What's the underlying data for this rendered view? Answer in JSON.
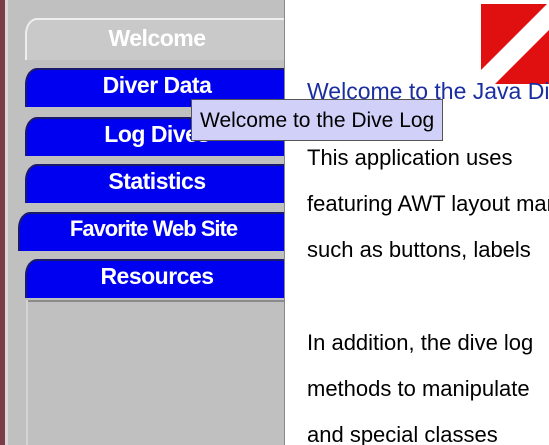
{
  "tabs": [
    {
      "label": "Welcome",
      "selected": true
    },
    {
      "label": "Diver Data",
      "selected": false
    },
    {
      "label": "Log Dives",
      "selected": false
    },
    {
      "label": "Statistics",
      "selected": false
    },
    {
      "label": "Favorite Web Site",
      "selected": false
    },
    {
      "label": "Resources",
      "selected": false
    }
  ],
  "tooltip": {
    "text": "Welcome to the Dive Log"
  },
  "content": {
    "title": "Welcome to the Java Dive Log",
    "paragraph1": [
      "This application uses",
      "featuring AWT layout managers",
      "such as buttons, labels"
    ],
    "paragraph2": [
      "In addition, the dive log",
      "methods to manipulate",
      "and special classes"
    ]
  },
  "colors": {
    "tab_blue": "#0000f0",
    "tab_selected": "#c9c9c9",
    "dive_flag_red": "#e01010",
    "tooltip_bg": "#d0d0f8"
  },
  "icons": {
    "logo": "dive-flag-icon"
  }
}
